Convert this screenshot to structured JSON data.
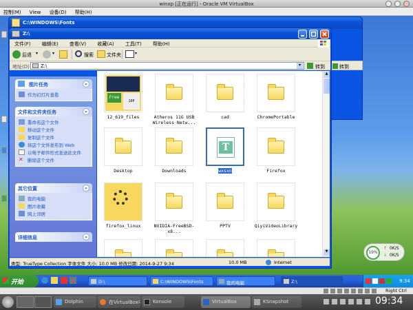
{
  "host": {
    "window_title": "winxp [正在运行] - Oracle VM VirtualBox",
    "menu": [
      "控制(M)",
      "View",
      "设备(D)",
      "帮助(H)"
    ],
    "status_right": "Right Ctrl"
  },
  "back_window": {
    "title": "C:\\WINDOWS\\Fonts",
    "go_label": "转到"
  },
  "back_window2": {
    "go_label": "转到"
  },
  "explorer": {
    "title": "Z:\\",
    "menu": [
      "文件(F)",
      "编辑(E)",
      "查看(V)",
      "收藏(A)",
      "工具(T)",
      "帮助(H)"
    ],
    "toolbar": {
      "back": "后退",
      "search": "搜索",
      "folders": "文件夹"
    },
    "address_label": "地址(D)",
    "address_value": "Z:\\",
    "go_label": "转到",
    "task_panels": [
      {
        "title": "图片任务",
        "items": [
          "作为幻灯片查看"
        ]
      },
      {
        "title": "文件和文件夹任务",
        "items": [
          "重命名这个文件",
          "移动这个文件",
          "复制这个文件",
          "将这个文件发布到 Web",
          "以电子邮件形式发送此文件",
          "删除这个文件"
        ]
      },
      {
        "title": "其它位置",
        "items": [
          "我的电脑",
          "图片收藏",
          "网上邻居"
        ]
      },
      {
        "title": "详细信息",
        "items": []
      }
    ],
    "files": [
      {
        "name": "12_619_files",
        "kind": "thumbfolder"
      },
      {
        "name": "Atheros 11G USB Wireless Netw...",
        "kind": "folder"
      },
      {
        "name": "cad",
        "kind": "folder"
      },
      {
        "name": "ChromePortable",
        "kind": "folder"
      },
      {
        "name": "Desktop",
        "kind": "folder"
      },
      {
        "name": "Downloads",
        "kind": "folder"
      },
      {
        "name": "wxsxn",
        "kind": "font",
        "selected": true
      },
      {
        "name": "Firefox",
        "kind": "folder"
      },
      {
        "name": "firefox_linux",
        "kind": "loading"
      },
      {
        "name": "NVIDIA-FreeBSD-x8...",
        "kind": "folder"
      },
      {
        "name": "PPTV",
        "kind": "folder"
      },
      {
        "name": "QiyiVideoLibrary",
        "kind": "folder"
      },
      {
        "name": "",
        "kind": "folder"
      },
      {
        "name": "",
        "kind": "folder"
      },
      {
        "name": "",
        "kind": "folder"
      },
      {
        "name": "",
        "kind": "folder"
      }
    ],
    "thumb_free_label": "Free",
    "thumb_badge_label": "10P",
    "status": {
      "text": "类型: TrueType Collection 字体文件 大小: 10.0 MB 修改日期: 2014-9-27 9:34",
      "size": "10.0 MB",
      "zone": "Internet"
    }
  },
  "desktop": {
    "gauge_percent": "19%",
    "net_up": "0K/S",
    "net_down": "0K/S"
  },
  "taskbar": {
    "start": "开始",
    "buttons": [
      "D:\\",
      "C:\\WINDOWS\\Fonts",
      "我的电脑",
      "Z:\\"
    ],
    "clock": "9:34"
  },
  "kde": {
    "tasks": [
      "Dolphin",
      "在VirtualBox中...",
      "Konsole",
      "VirtualBox",
      "KSnapshot"
    ],
    "clock": "09:34"
  },
  "colors": {
    "xp_blue": "#0a55e3",
    "task_pane": "#6375d6",
    "taskbar": "#245edb",
    "start_green": "#3c9a3c",
    "selection": "#316ac5"
  }
}
